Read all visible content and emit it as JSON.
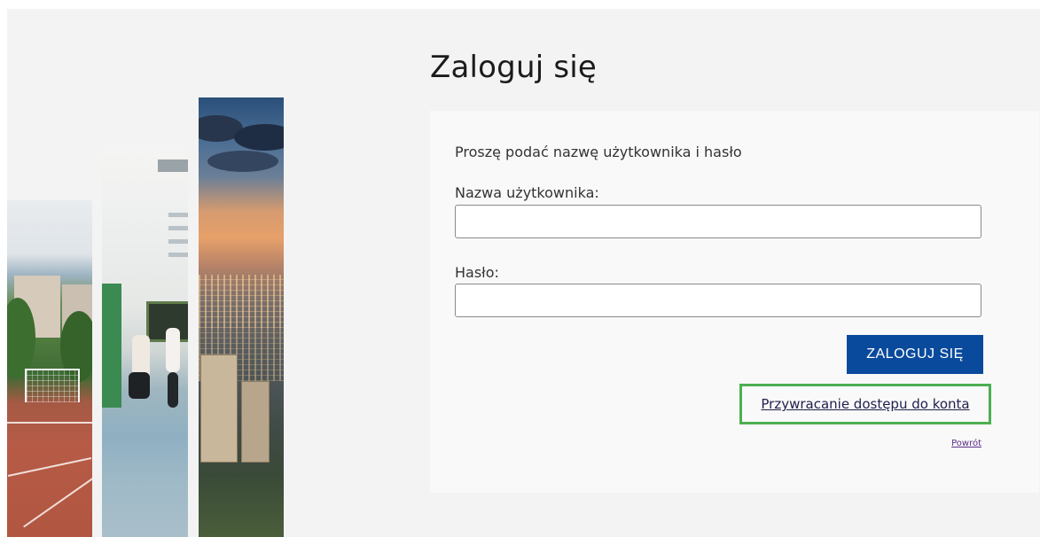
{
  "login": {
    "title": "Zaloguj się",
    "instruction": "Proszę podać nazwę użytkownika i hasło",
    "username_label": "Nazwa użytkownika:",
    "username_value": "",
    "password_label": "Hasło:",
    "password_value": "",
    "submit_label": "ZALOGUJ SIĘ",
    "recover_link": "Przywracanie dostępu do konta",
    "back_link": "Powrót"
  },
  "colors": {
    "button": "#0a4a9c",
    "highlight": "#4caf50",
    "background": "#f3f3f3",
    "card": "#f9f9f9"
  }
}
